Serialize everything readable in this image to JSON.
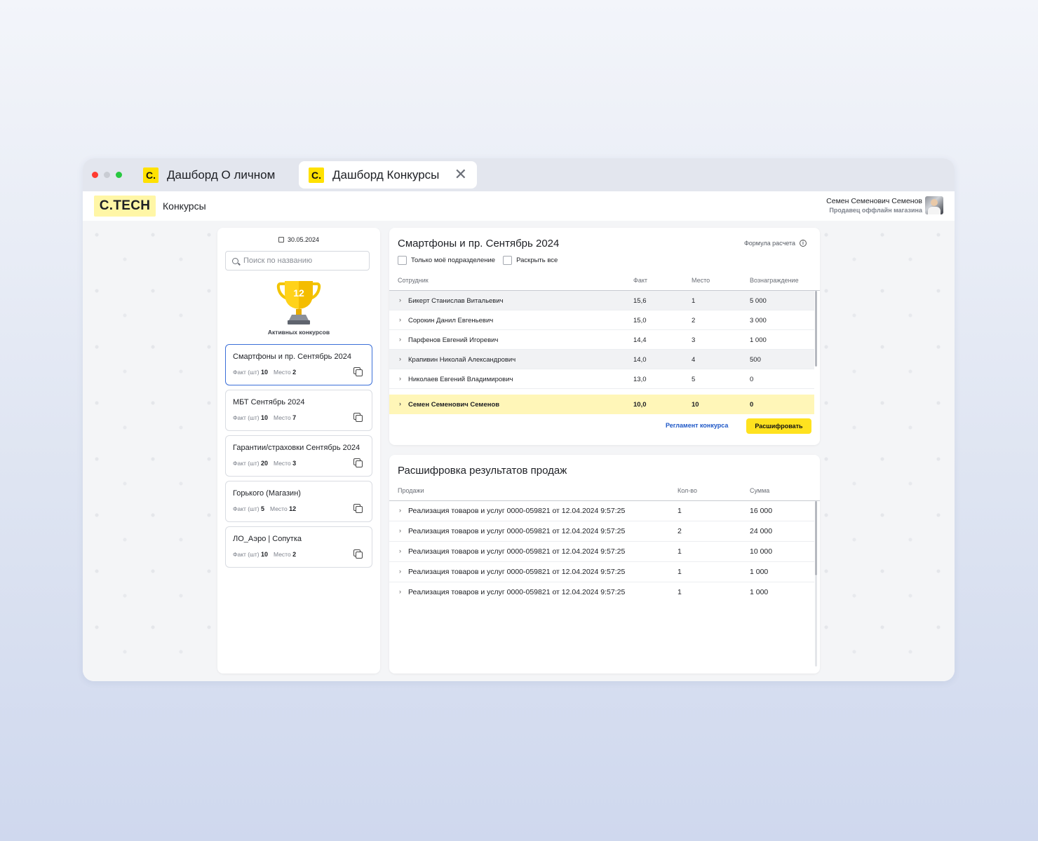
{
  "tabs": [
    {
      "icon": "С.",
      "label": "Дашборд О личном"
    },
    {
      "icon": "С.",
      "label": "Дашборд Конкурсы",
      "close": "✕"
    }
  ],
  "header": {
    "logo": "С.TECH",
    "title": "Конкурсы",
    "user_name": "Семен Семенович Семенов",
    "user_role": "Продавец оффлайн магазина"
  },
  "sidebar": {
    "date": "30.05.2024",
    "search_placeholder": "Поиск по названию",
    "active_count": "12",
    "active_label": "Активных конкурсов",
    "fact_label": "Факт (шт)",
    "place_label": "Место",
    "contests": [
      {
        "name": "Смартфоны и пр. Сентябрь 2024",
        "fact": "10",
        "place": "2"
      },
      {
        "name": "МБТ Сентябрь 2024",
        "fact": "10",
        "place": "7"
      },
      {
        "name": "Гарантии/страховки Сентябрь 2024",
        "fact": "20",
        "place": "3"
      },
      {
        "name": "Горького (Магазин)",
        "fact": "5",
        "place": "12"
      },
      {
        "name": "ЛО_Аэро | Сопутка",
        "fact": "10",
        "place": "2"
      }
    ]
  },
  "rating": {
    "title": "Смартфоны и пр. Сентябрь 2024",
    "formula_label": "Формула расчета",
    "check_own": "Только моё подразделение",
    "check_expand": "Раскрыть все",
    "columns": [
      "Сотрудник",
      "Факт",
      "Место",
      "Вознаграждение"
    ],
    "rows": [
      {
        "name": "Бикерт Станислав Витальевич",
        "fact": "15,6",
        "place": "1",
        "reward": "5 000"
      },
      {
        "name": "Сорокин Данил Евгеньевич",
        "fact": "15,0",
        "place": "2",
        "reward": "3 000"
      },
      {
        "name": "Парфенов Евгений Игоревич",
        "fact": "14,4",
        "place": "3",
        "reward": "1 000"
      },
      {
        "name": "Крапивин Николай Александрович",
        "fact": "14,0",
        "place": "4",
        "reward": "500"
      },
      {
        "name": "Николаев Евгений Владимирович",
        "fact": "13,0",
        "place": "5",
        "reward": "0"
      }
    ],
    "me": {
      "name": "Семен Семенович Семенов",
      "fact": "10,0",
      "place": "10",
      "reward": "0"
    },
    "rules_link": "Регламент конкурса",
    "decode_button": "Расшифровать"
  },
  "details": {
    "title": "Расшифровка результатов продаж",
    "columns": [
      "Продажи",
      "Кол-во",
      "Сумма"
    ],
    "rows": [
      {
        "name": "Реализация товаров и услуг 0000-059821 от 12.04.2024 9:57:25",
        "qty": "1",
        "sum": "16 000"
      },
      {
        "name": "Реализация товаров и услуг 0000-059821 от 12.04.2024 9:57:25",
        "qty": "2",
        "sum": "24 000"
      },
      {
        "name": "Реализация товаров и услуг 0000-059821 от 12.04.2024 9:57:25",
        "qty": "1",
        "sum": "10 000"
      },
      {
        "name": "Реализация товаров и услуг 0000-059821 от 12.04.2024 9:57:25",
        "qty": "1",
        "sum": "1 000"
      },
      {
        "name": "Реализация товаров и услуг 0000-059821 от 12.04.2024 9:57:25",
        "qty": "1",
        "sum": "1 000"
      }
    ]
  },
  "colors": {
    "accent": "#ffe21f",
    "highlight": "#fff6b8",
    "link": "#1f58c7",
    "selected_border": "#3b6fd8"
  }
}
